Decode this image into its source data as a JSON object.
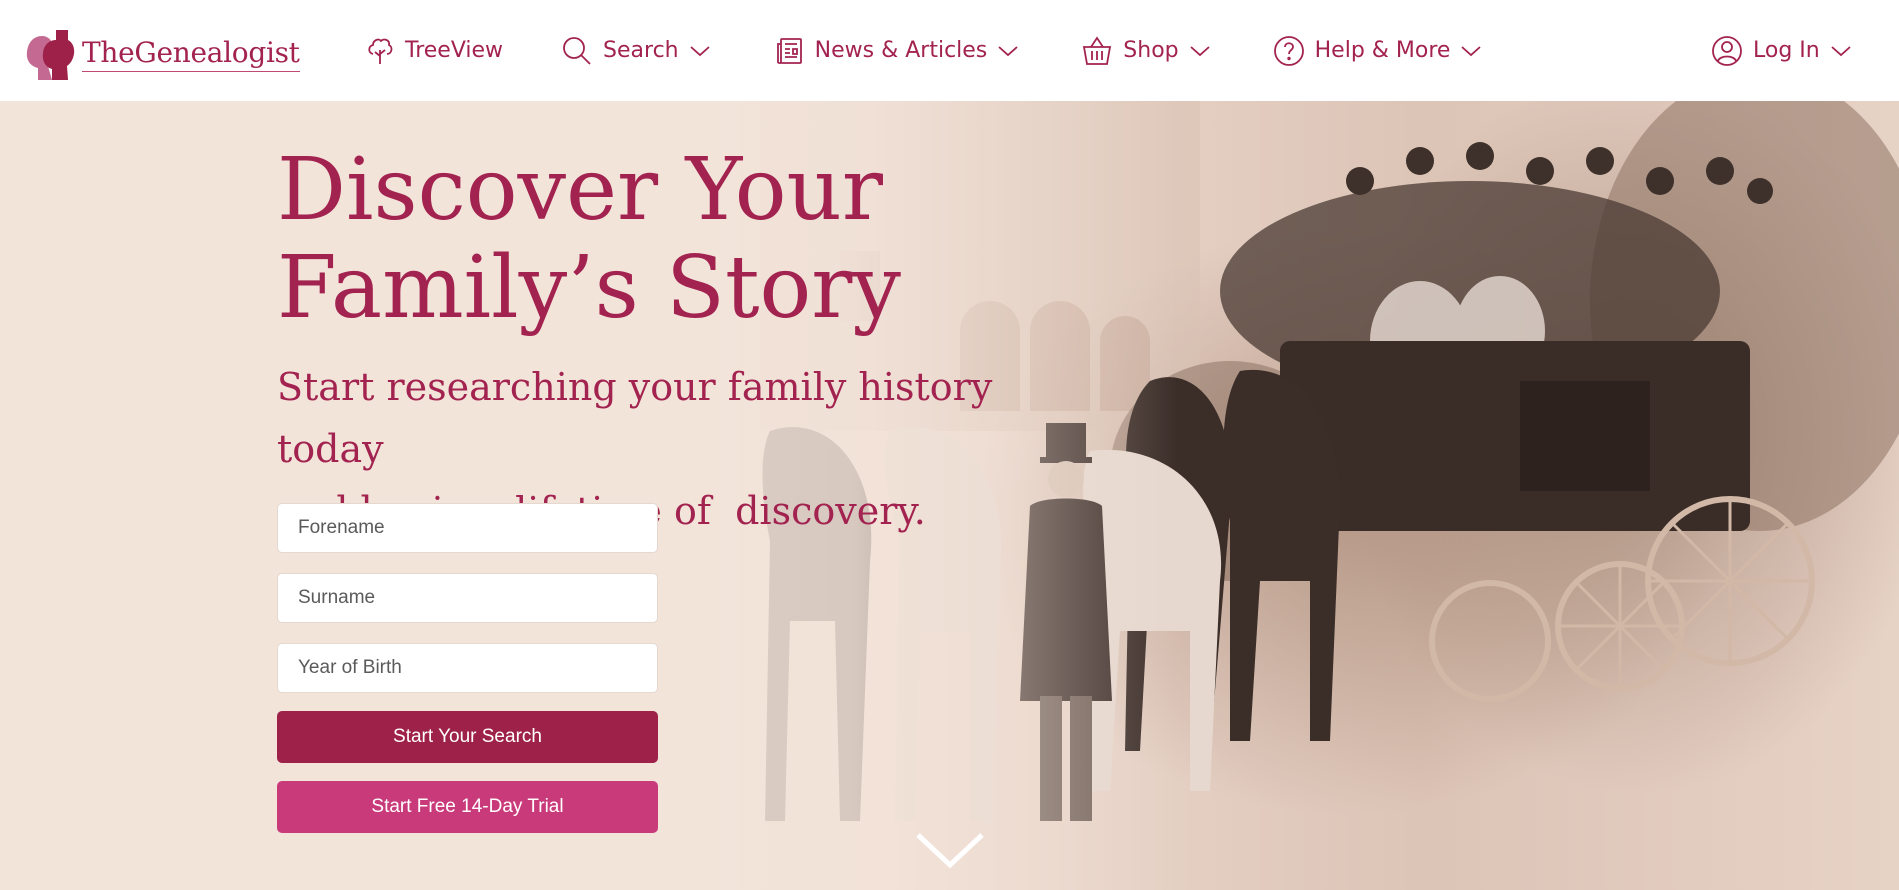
{
  "brand": {
    "name": "TheGenealogist",
    "color": "#a32350",
    "accent": "#c93a7b"
  },
  "nav": {
    "items": [
      {
        "label": "TreeView",
        "icon": "tree-icon",
        "has_dropdown": false
      },
      {
        "label": "Search",
        "icon": "search-icon",
        "has_dropdown": true
      },
      {
        "label": "News & Articles",
        "icon": "newspaper-icon",
        "has_dropdown": true
      },
      {
        "label": "Shop",
        "icon": "basket-icon",
        "has_dropdown": true
      },
      {
        "label": "Help & More",
        "icon": "help-icon",
        "has_dropdown": true
      }
    ],
    "login": {
      "label": "Log In",
      "icon": "user-icon",
      "has_dropdown": true
    }
  },
  "hero": {
    "headline_line1": "Discover Your",
    "headline_line2": "Family’s Story",
    "subhead_line1": "Start researching your family history today",
    "subhead_line2": "and begin a lifetime of  discovery."
  },
  "search_form": {
    "forename_placeholder": "Forename",
    "surname_placeholder": "Surname",
    "year_placeholder": "Year of Birth",
    "forename_value": "",
    "surname_value": "",
    "year_value": "",
    "search_button": "Start Your Search",
    "trial_button": "Start Free 14-Day Trial"
  },
  "scroll_indicator": {
    "icon": "chevron-down-icon"
  }
}
